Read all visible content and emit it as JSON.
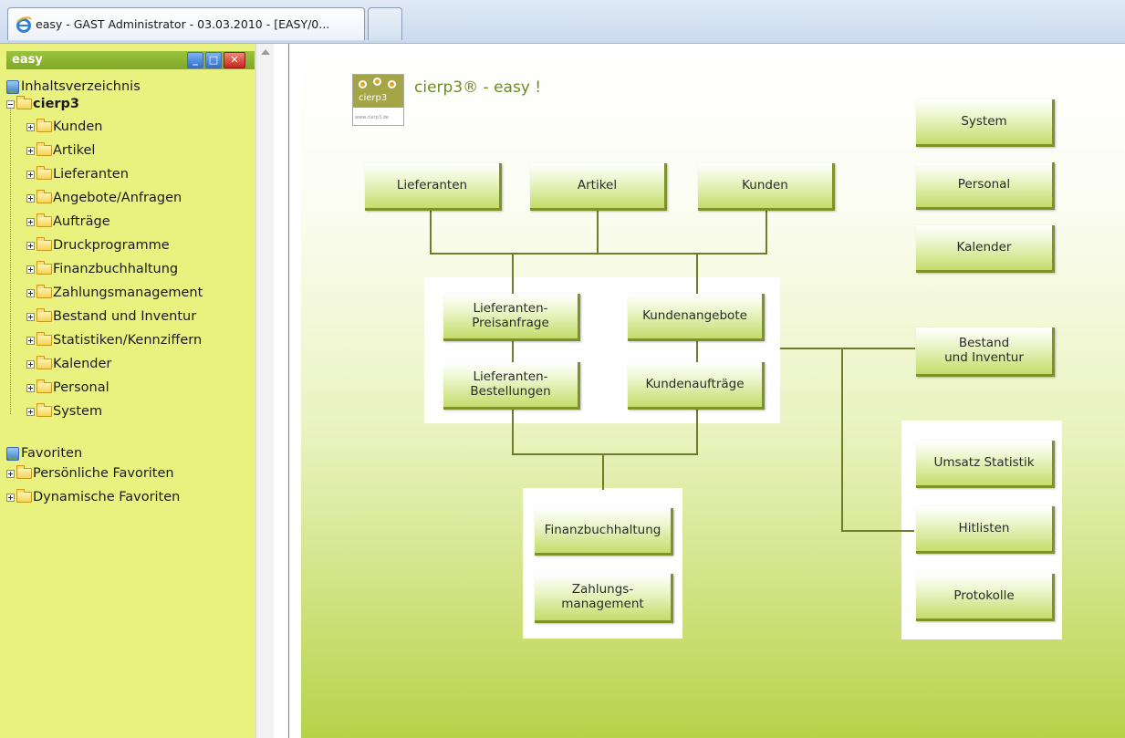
{
  "browser": {
    "tab_title": "easy - GAST Administrator - 03.03.2010 - [EASY/0..."
  },
  "sidebar": {
    "header_title": "easy",
    "tree_root_label": "Inhaltsverzeichnis",
    "tree_main": "cierp3",
    "items": [
      {
        "label": "Kunden"
      },
      {
        "label": "Artikel"
      },
      {
        "label": "Lieferanten"
      },
      {
        "label": "Angebote/Anfragen"
      },
      {
        "label": "Aufträge"
      },
      {
        "label": "Druckprogramme"
      },
      {
        "label": "Finanzbuchhaltung"
      },
      {
        "label": "Zahlungsmanagement"
      },
      {
        "label": "Bestand und Inventur"
      },
      {
        "label": "Statistiken/Kennziffern"
      },
      {
        "label": "Kalender"
      },
      {
        "label": "Personal"
      },
      {
        "label": "System"
      }
    ],
    "favorites_root": "Favoriten",
    "favorites": [
      {
        "label": "Persönliche Favoriten"
      },
      {
        "label": "Dynamische Favoriten"
      }
    ]
  },
  "content": {
    "logo_text": "cierp3",
    "logo_url": "www.cierp3.de",
    "brand": "cierp3® - easy !",
    "buttons": {
      "lieferanten": "Lieferanten",
      "artikel": "Artikel",
      "kunden": "Kunden",
      "system": "System",
      "personal": "Personal",
      "kalender": "Kalender",
      "preisanfrage": "Lieferanten-\nPreisanfrage",
      "kundenangebote": "Kundenangebote",
      "bestellungen": "Lieferanten-\nBestellungen",
      "kundenauftraege": "Kundenaufträge",
      "bestand": "Bestand\nund Inventur",
      "umsatz": "Umsatz Statistik",
      "hitlisten": "Hitlisten",
      "protokolle": "Protokolle",
      "finanz": "Finanzbuchhaltung",
      "zahlungs": "Zahlungs-\nmanagement"
    }
  }
}
